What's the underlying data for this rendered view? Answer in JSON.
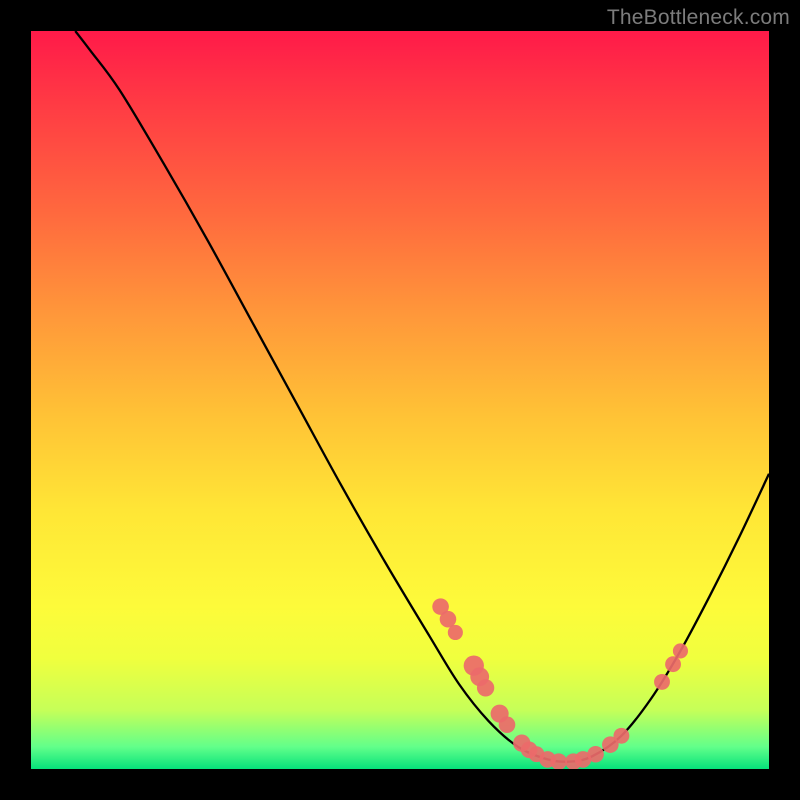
{
  "watermark": "TheBottleneck.com",
  "chart_data": {
    "type": "line",
    "title": "",
    "xlabel": "",
    "ylabel": "",
    "xlim": [
      0,
      100
    ],
    "ylim": [
      0,
      100
    ],
    "curve": [
      {
        "x": 6.0,
        "y": 100.0
      },
      {
        "x": 8.0,
        "y": 97.4
      },
      {
        "x": 12.0,
        "y": 92.0
      },
      {
        "x": 18.0,
        "y": 82.0
      },
      {
        "x": 24.0,
        "y": 71.5
      },
      {
        "x": 30.0,
        "y": 60.5
      },
      {
        "x": 36.0,
        "y": 49.5
      },
      {
        "x": 42.0,
        "y": 38.5
      },
      {
        "x": 48.0,
        "y": 28.0
      },
      {
        "x": 54.0,
        "y": 18.0
      },
      {
        "x": 58.0,
        "y": 11.5
      },
      {
        "x": 62.0,
        "y": 6.5
      },
      {
        "x": 66.0,
        "y": 3.0
      },
      {
        "x": 70.0,
        "y": 1.3
      },
      {
        "x": 73.0,
        "y": 1.0
      },
      {
        "x": 76.0,
        "y": 1.7
      },
      {
        "x": 80.0,
        "y": 4.5
      },
      {
        "x": 84.0,
        "y": 9.5
      },
      {
        "x": 88.0,
        "y": 16.0
      },
      {
        "x": 92.0,
        "y": 23.5
      },
      {
        "x": 96.0,
        "y": 31.5
      },
      {
        "x": 100.0,
        "y": 40.0
      }
    ],
    "markers": [
      {
        "x": 55.5,
        "y": 22.0,
        "r": 1.3
      },
      {
        "x": 56.5,
        "y": 20.3,
        "r": 1.3
      },
      {
        "x": 57.5,
        "y": 18.5,
        "r": 1.1
      },
      {
        "x": 60.0,
        "y": 14.0,
        "r": 1.8
      },
      {
        "x": 60.8,
        "y": 12.5,
        "r": 1.6
      },
      {
        "x": 61.6,
        "y": 11.0,
        "r": 1.4
      },
      {
        "x": 63.5,
        "y": 7.5,
        "r": 1.5
      },
      {
        "x": 64.5,
        "y": 6.0,
        "r": 1.3
      },
      {
        "x": 66.5,
        "y": 3.5,
        "r": 1.4
      },
      {
        "x": 67.5,
        "y": 2.6,
        "r": 1.3
      },
      {
        "x": 68.5,
        "y": 2.0,
        "r": 1.2
      },
      {
        "x": 70.0,
        "y": 1.3,
        "r": 1.3
      },
      {
        "x": 71.5,
        "y": 1.0,
        "r": 1.3
      },
      {
        "x": 73.5,
        "y": 1.0,
        "r": 1.3
      },
      {
        "x": 74.8,
        "y": 1.3,
        "r": 1.3
      },
      {
        "x": 76.5,
        "y": 2.0,
        "r": 1.3
      },
      {
        "x": 78.5,
        "y": 3.3,
        "r": 1.3
      },
      {
        "x": 80.0,
        "y": 4.5,
        "r": 1.2
      },
      {
        "x": 85.5,
        "y": 11.8,
        "r": 1.2
      },
      {
        "x": 87.0,
        "y": 14.2,
        "r": 1.2
      },
      {
        "x": 88.0,
        "y": 16.0,
        "r": 1.1
      }
    ],
    "marker_color": "#ec6a6a",
    "line_color": "#000000"
  }
}
